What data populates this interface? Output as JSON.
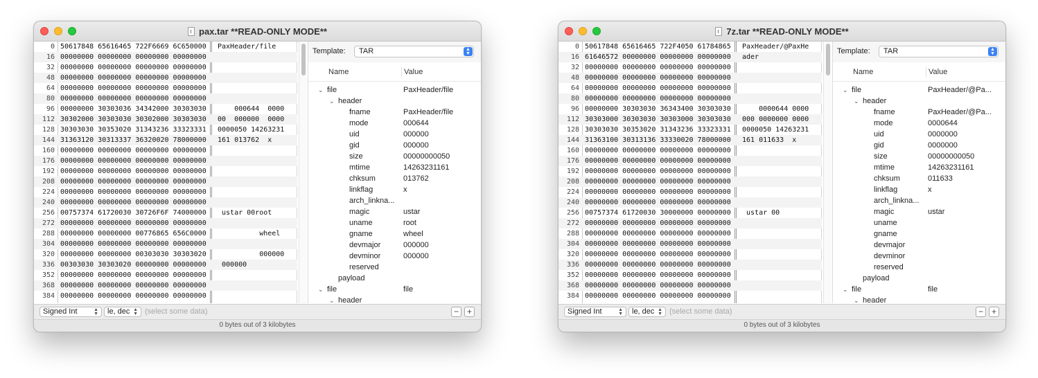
{
  "windows": [
    {
      "title": "pax.tar **READ-ONLY MODE**",
      "hex_rows": [
        {
          "offset": "0",
          "hex": "50617848 65616465 722F6669 6C650000",
          "ascii": "PaxHeader/file"
        },
        {
          "offset": "16",
          "hex": "00000000 00000000 00000000 00000000",
          "ascii": ""
        },
        {
          "offset": "32",
          "hex": "00000000 00000000 00000000 00000000",
          "ascii": ""
        },
        {
          "offset": "48",
          "hex": "00000000 00000000 00000000 00000000",
          "ascii": ""
        },
        {
          "offset": "64",
          "hex": "00000000 00000000 00000000 00000000",
          "ascii": ""
        },
        {
          "offset": "80",
          "hex": "00000000 00000000 00000000 00000000",
          "ascii": ""
        },
        {
          "offset": "96",
          "hex": "00000000 30303036 34342000 30303030",
          "ascii": "    000644  0000"
        },
        {
          "offset": "112",
          "hex": "30302000 30303030 30302000 30303030",
          "ascii": "00  000000  0000"
        },
        {
          "offset": "128",
          "hex": "30303030 30353020 31343236 33323331",
          "ascii": "0000050 14263231"
        },
        {
          "offset": "144",
          "hex": "31363120 30313337 36320020 78000000",
          "ascii": "161 013762  x"
        },
        {
          "offset": "160",
          "hex": "00000000 00000000 00000000 00000000",
          "ascii": ""
        },
        {
          "offset": "176",
          "hex": "00000000 00000000 00000000 00000000",
          "ascii": ""
        },
        {
          "offset": "192",
          "hex": "00000000 00000000 00000000 00000000",
          "ascii": ""
        },
        {
          "offset": "208",
          "hex": "00000000 00000000 00000000 00000000",
          "ascii": ""
        },
        {
          "offset": "224",
          "hex": "00000000 00000000 00000000 00000000",
          "ascii": ""
        },
        {
          "offset": "240",
          "hex": "00000000 00000000 00000000 00000000",
          "ascii": ""
        },
        {
          "offset": "256",
          "hex": "00757374 61720030 30726F6F 74000000",
          "ascii": " ustar 00root"
        },
        {
          "offset": "272",
          "hex": "00000000 00000000 00000000 00000000",
          "ascii": ""
        },
        {
          "offset": "288",
          "hex": "00000000 00000000 00776865 656C0000",
          "ascii": "          wheel"
        },
        {
          "offset": "304",
          "hex": "00000000 00000000 00000000 00000000",
          "ascii": ""
        },
        {
          "offset": "320",
          "hex": "00000000 00000000 00303030 30303020",
          "ascii": "          000000"
        },
        {
          "offset": "336",
          "hex": "00303030 30303020 00000000 00000000",
          "ascii": " 000000"
        },
        {
          "offset": "352",
          "hex": "00000000 00000000 00000000 00000000",
          "ascii": ""
        },
        {
          "offset": "368",
          "hex": "00000000 00000000 00000000 00000000",
          "ascii": ""
        },
        {
          "offset": "384",
          "hex": "00000000 00000000 00000000 00000000",
          "ascii": ""
        }
      ],
      "template_label": "Template:",
      "template_value": "TAR",
      "tree_headers": {
        "name": "Name",
        "value": "Value"
      },
      "tree_rows": [
        {
          "level": 0,
          "expand": true,
          "name": "file",
          "value": "PaxHeader/file"
        },
        {
          "level": 1,
          "expand": true,
          "name": "header",
          "value": ""
        },
        {
          "level": 2,
          "expand": false,
          "name": "fname",
          "value": "PaxHeader/file"
        },
        {
          "level": 2,
          "expand": false,
          "name": "mode",
          "value": "000644"
        },
        {
          "level": 2,
          "expand": false,
          "name": "uid",
          "value": "000000"
        },
        {
          "level": 2,
          "expand": false,
          "name": "gid",
          "value": "000000"
        },
        {
          "level": 2,
          "expand": false,
          "name": "size",
          "value": "00000000050"
        },
        {
          "level": 2,
          "expand": false,
          "name": "mtime",
          "value": "14263231161"
        },
        {
          "level": 2,
          "expand": false,
          "name": "chksum",
          "value": "013762"
        },
        {
          "level": 2,
          "expand": false,
          "name": "linkflag",
          "value": "x"
        },
        {
          "level": 2,
          "expand": false,
          "name": "arch_linkna...",
          "value": ""
        },
        {
          "level": 2,
          "expand": false,
          "name": "magic",
          "value": "ustar"
        },
        {
          "level": 2,
          "expand": false,
          "name": "uname",
          "value": "root"
        },
        {
          "level": 2,
          "expand": false,
          "name": "gname",
          "value": "wheel"
        },
        {
          "level": 2,
          "expand": false,
          "name": "devmajor",
          "value": "000000"
        },
        {
          "level": 2,
          "expand": false,
          "name": "devminor",
          "value": "000000"
        },
        {
          "level": 2,
          "expand": false,
          "name": "reserved",
          "value": ""
        },
        {
          "level": 1,
          "expand": false,
          "name": "payload",
          "value": ""
        },
        {
          "level": 0,
          "expand": true,
          "name": "file",
          "value": "file"
        },
        {
          "level": 1,
          "expand": true,
          "name": "header",
          "value": ""
        }
      ],
      "type_select": "Signed Int",
      "endian_select": "le, dec",
      "select_hint": "(select some data)",
      "minus_label": "−",
      "plus_label": "+",
      "status": "0 bytes out of 3 kilobytes"
    },
    {
      "title": "7z.tar **READ-ONLY MODE**",
      "hex_rows": [
        {
          "offset": "0",
          "hex": "50617848 65616465 722F4050 61784865",
          "ascii": "PaxHeader/@PaxHe"
        },
        {
          "offset": "16",
          "hex": "61646572 00000000 00000000 00000000",
          "ascii": "ader"
        },
        {
          "offset": "32",
          "hex": "00000000 00000000 00000000 00000000",
          "ascii": ""
        },
        {
          "offset": "48",
          "hex": "00000000 00000000 00000000 00000000",
          "ascii": ""
        },
        {
          "offset": "64",
          "hex": "00000000 00000000 00000000 00000000",
          "ascii": ""
        },
        {
          "offset": "80",
          "hex": "00000000 00000000 00000000 00000000",
          "ascii": ""
        },
        {
          "offset": "96",
          "hex": "00000000 30303030 36343400 30303030",
          "ascii": "    0000644 0000"
        },
        {
          "offset": "112",
          "hex": "30303000 30303030 30303000 30303030",
          "ascii": "000 0000000 0000"
        },
        {
          "offset": "128",
          "hex": "30303030 30353020 31343236 33323331",
          "ascii": "0000050 14263231"
        },
        {
          "offset": "144",
          "hex": "31363100 30313136 33330020 78000000",
          "ascii": "161 011633  x"
        },
        {
          "offset": "160",
          "hex": "00000000 00000000 00000000 00000000",
          "ascii": ""
        },
        {
          "offset": "176",
          "hex": "00000000 00000000 00000000 00000000",
          "ascii": ""
        },
        {
          "offset": "192",
          "hex": "00000000 00000000 00000000 00000000",
          "ascii": ""
        },
        {
          "offset": "208",
          "hex": "00000000 00000000 00000000 00000000",
          "ascii": ""
        },
        {
          "offset": "224",
          "hex": "00000000 00000000 00000000 00000000",
          "ascii": ""
        },
        {
          "offset": "240",
          "hex": "00000000 00000000 00000000 00000000",
          "ascii": ""
        },
        {
          "offset": "256",
          "hex": "00757374 61720030 30000000 00000000",
          "ascii": " ustar 00"
        },
        {
          "offset": "272",
          "hex": "00000000 00000000 00000000 00000000",
          "ascii": ""
        },
        {
          "offset": "288",
          "hex": "00000000 00000000 00000000 00000000",
          "ascii": ""
        },
        {
          "offset": "304",
          "hex": "00000000 00000000 00000000 00000000",
          "ascii": ""
        },
        {
          "offset": "320",
          "hex": "00000000 00000000 00000000 00000000",
          "ascii": ""
        },
        {
          "offset": "336",
          "hex": "00000000 00000000 00000000 00000000",
          "ascii": ""
        },
        {
          "offset": "352",
          "hex": "00000000 00000000 00000000 00000000",
          "ascii": ""
        },
        {
          "offset": "368",
          "hex": "00000000 00000000 00000000 00000000",
          "ascii": ""
        },
        {
          "offset": "384",
          "hex": "00000000 00000000 00000000 00000000",
          "ascii": ""
        }
      ],
      "template_label": "Template:",
      "template_value": "TAR",
      "tree_headers": {
        "name": "Name",
        "value": "Value"
      },
      "tree_rows": [
        {
          "level": 0,
          "expand": true,
          "name": "file",
          "value": "PaxHeader/@Pa..."
        },
        {
          "level": 1,
          "expand": true,
          "name": "header",
          "value": ""
        },
        {
          "level": 2,
          "expand": false,
          "name": "fname",
          "value": "PaxHeader/@Pa..."
        },
        {
          "level": 2,
          "expand": false,
          "name": "mode",
          "value": "0000644"
        },
        {
          "level": 2,
          "expand": false,
          "name": "uid",
          "value": "0000000"
        },
        {
          "level": 2,
          "expand": false,
          "name": "gid",
          "value": "0000000"
        },
        {
          "level": 2,
          "expand": false,
          "name": "size",
          "value": "00000000050"
        },
        {
          "level": 2,
          "expand": false,
          "name": "mtime",
          "value": "14263231161"
        },
        {
          "level": 2,
          "expand": false,
          "name": "chksum",
          "value": "011633"
        },
        {
          "level": 2,
          "expand": false,
          "name": "linkflag",
          "value": "x"
        },
        {
          "level": 2,
          "expand": false,
          "name": "arch_linkna...",
          "value": ""
        },
        {
          "level": 2,
          "expand": false,
          "name": "magic",
          "value": "ustar"
        },
        {
          "level": 2,
          "expand": false,
          "name": "uname",
          "value": ""
        },
        {
          "level": 2,
          "expand": false,
          "name": "gname",
          "value": ""
        },
        {
          "level": 2,
          "expand": false,
          "name": "devmajor",
          "value": ""
        },
        {
          "level": 2,
          "expand": false,
          "name": "devminor",
          "value": ""
        },
        {
          "level": 2,
          "expand": false,
          "name": "reserved",
          "value": ""
        },
        {
          "level": 1,
          "expand": false,
          "name": "payload",
          "value": ""
        },
        {
          "level": 0,
          "expand": true,
          "name": "file",
          "value": "file"
        },
        {
          "level": 1,
          "expand": true,
          "name": "header",
          "value": ""
        }
      ],
      "type_select": "Signed Int",
      "endian_select": "le, dec",
      "select_hint": "(select some data)",
      "minus_label": "−",
      "plus_label": "+",
      "status": "0 bytes out of 3 kilobytes"
    }
  ]
}
